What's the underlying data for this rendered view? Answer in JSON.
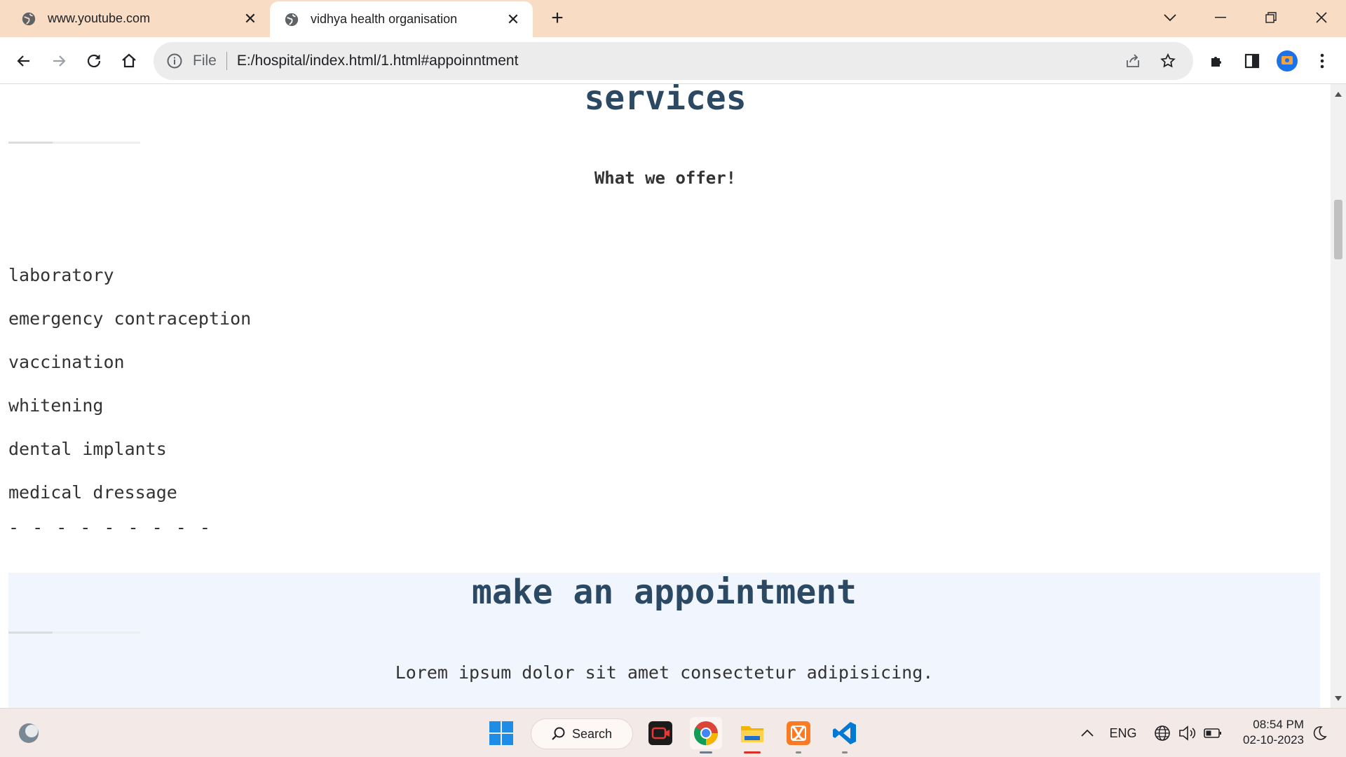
{
  "browser": {
    "tabs": [
      {
        "title": "www.youtube.com",
        "active": false
      },
      {
        "title": "vidhya health organisation",
        "active": true
      }
    ],
    "new_tab_label": "+",
    "omnibox": {
      "scheme_label": "File",
      "url": "E:/hospital/index.html/1.html#appoinntment"
    }
  },
  "page": {
    "services": {
      "heading": "services",
      "subheading": "What we offer!",
      "items": [
        "laboratory",
        "emergency contraception",
        "vaccination",
        "whitening",
        "dental implants",
        "medical dressage"
      ],
      "dashes": "- - - - - - - - -"
    },
    "appointment": {
      "heading": "make an appointment",
      "subheading": "Lorem ipsum dolor sit amet consectetur adipisicing."
    }
  },
  "taskbar": {
    "search_label": "Search",
    "language": "ENG",
    "time": "08:54 PM",
    "date": "02-10-2023"
  },
  "colors": {
    "tabstrip": "#f9dcc4",
    "heading": "#2c4964",
    "appointment_bg": "#f1f6fe"
  }
}
